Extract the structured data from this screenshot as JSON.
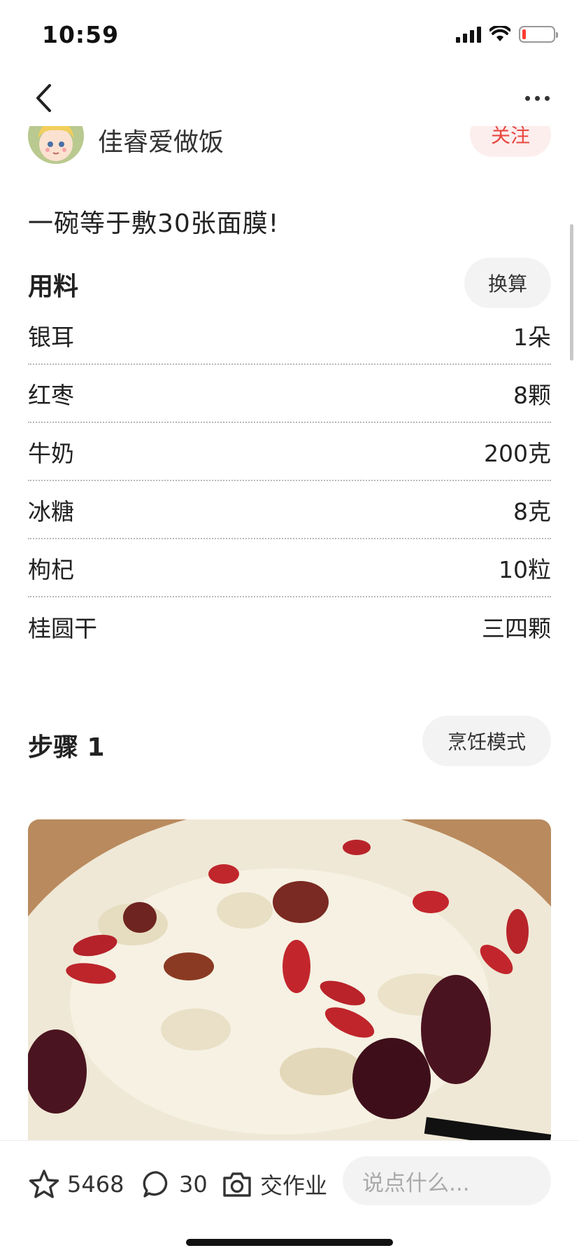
{
  "status_bar": {
    "time": "10:59"
  },
  "nav": {
    "back_icon": "chevron-left-icon",
    "more_icon": "more-horizontal-icon"
  },
  "author": {
    "name": "佳睿爱做饭",
    "follow_label": "关注"
  },
  "recipe": {
    "description": "一碗等于敷30张面膜!"
  },
  "ingredients_section": {
    "title": "用料",
    "convert_label": "换算",
    "items": [
      {
        "name": "银耳",
        "amount": "1朵"
      },
      {
        "name": "红枣",
        "amount": "8颗"
      },
      {
        "name": "牛奶",
        "amount": "200克"
      },
      {
        "name": "冰糖",
        "amount": "8克"
      },
      {
        "name": "枸杞",
        "amount": "10粒"
      },
      {
        "name": "桂圆干",
        "amount": "三四颗"
      }
    ]
  },
  "step": {
    "title": "步骤 1",
    "cooking_mode_label": "烹饪模式"
  },
  "bottom_bar": {
    "favorites_count": "5468",
    "comments_count": "30",
    "homework_label": "交作业",
    "comment_placeholder": "说点什么..."
  },
  "colors": {
    "accent": "#e8483f",
    "follow_bg": "#fdeeee",
    "pill_bg": "#f3f3f3"
  }
}
